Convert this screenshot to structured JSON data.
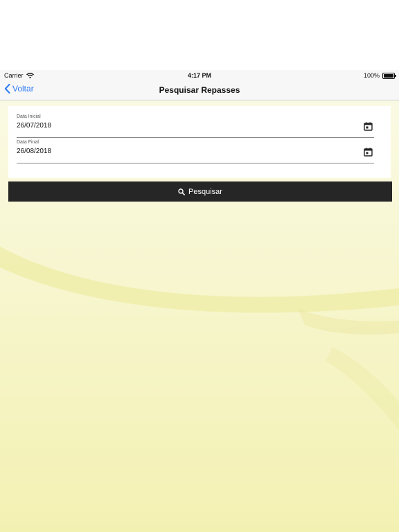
{
  "status_bar": {
    "carrier": "Carrier",
    "time": "4:17 PM",
    "battery": "100%",
    "icons": [
      "wifi-icon",
      "battery-icon"
    ]
  },
  "nav": {
    "back_label": "Voltar",
    "title": "Pesquisar Repasses"
  },
  "form": {
    "start_date": {
      "label": "Data Inicial",
      "value": "26/07/2018",
      "icon": "calendar-icon"
    },
    "end_date": {
      "label": "Data Final",
      "value": "26/08/2018",
      "icon": "calendar-icon"
    }
  },
  "search_button": {
    "label": "Pesquisar",
    "icon": "search-icon"
  },
  "colors": {
    "accent": "#2f7cf6",
    "button_bg": "#262626",
    "background_yellow": "#f4f2b6"
  }
}
